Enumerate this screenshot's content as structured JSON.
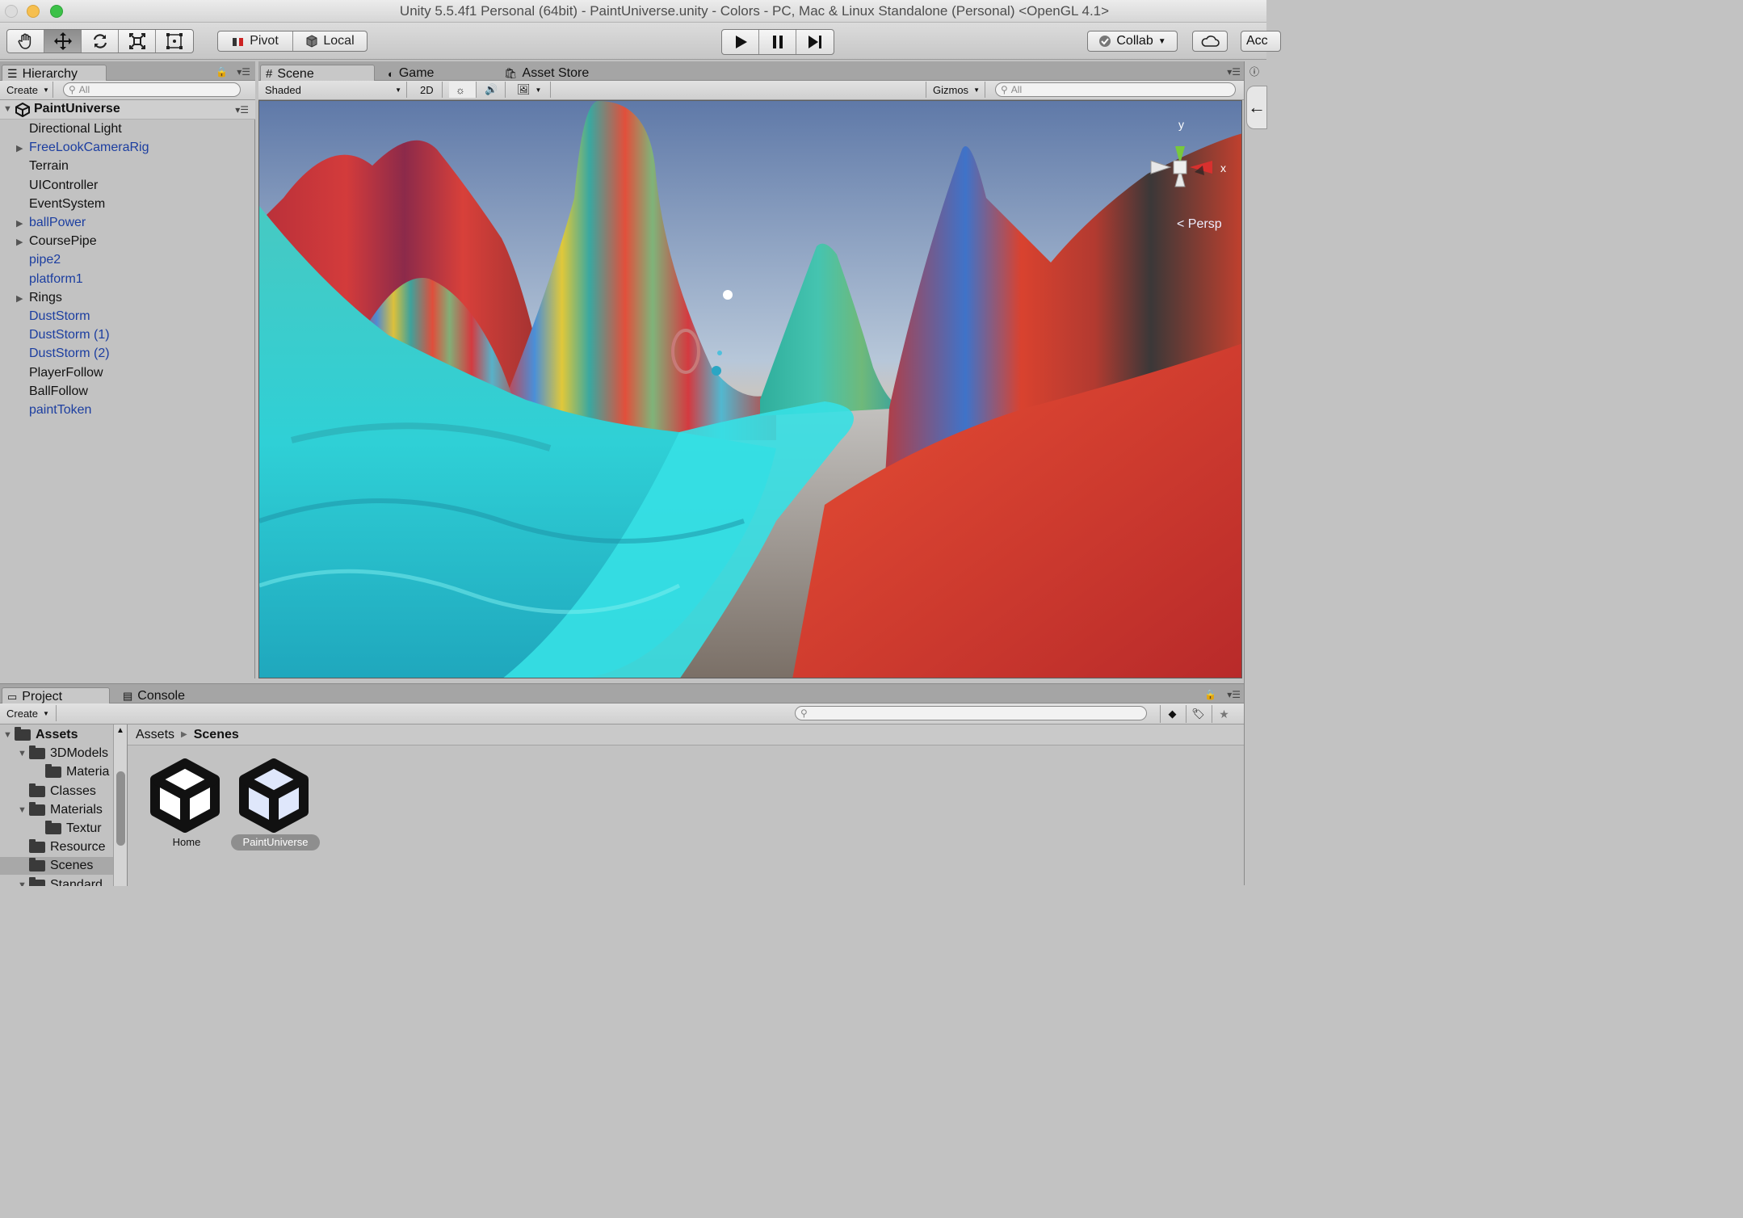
{
  "window": {
    "title": "Unity 5.5.4f1 Personal (64bit) - PaintUniverse.unity - Colors - PC, Mac & Linux Standalone (Personal) <OpenGL 4.1>"
  },
  "toolbar": {
    "tools": [
      "hand-tool",
      "move-tool",
      "rotate-tool",
      "scale-tool",
      "rect-tool"
    ],
    "active_tool": "move-tool",
    "pivot_label": "Pivot",
    "local_label": "Local",
    "collab_label": "Collab",
    "account_label": "Acc"
  },
  "hierarchy": {
    "tab_label": "Hierarchy",
    "create_label": "Create",
    "search_placeholder": "All",
    "scene_name": "PaintUniverse",
    "items": [
      {
        "label": "Directional Light",
        "prefab": false,
        "expandable": false
      },
      {
        "label": "FreeLookCameraRig",
        "prefab": true,
        "expandable": true
      },
      {
        "label": "Terrain",
        "prefab": false,
        "expandable": false
      },
      {
        "label": "UIController",
        "prefab": false,
        "expandable": false
      },
      {
        "label": "EventSystem",
        "prefab": false,
        "expandable": false
      },
      {
        "label": "ballPower",
        "prefab": true,
        "expandable": true
      },
      {
        "label": "CoursePipe",
        "prefab": false,
        "expandable": true
      },
      {
        "label": "pipe2",
        "prefab": true,
        "expandable": false
      },
      {
        "label": "platform1",
        "prefab": true,
        "expandable": false
      },
      {
        "label": "Rings",
        "prefab": false,
        "expandable": true
      },
      {
        "label": "DustStorm",
        "prefab": true,
        "expandable": false
      },
      {
        "label": "DustStorm (1)",
        "prefab": true,
        "expandable": false
      },
      {
        "label": "DustStorm (2)",
        "prefab": true,
        "expandable": false
      },
      {
        "label": "PlayerFollow",
        "prefab": false,
        "expandable": false
      },
      {
        "label": "BallFollow",
        "prefab": false,
        "expandable": false
      },
      {
        "label": "paintToken",
        "prefab": true,
        "expandable": false
      }
    ]
  },
  "scene_tabs": [
    {
      "label": "Scene",
      "selected": true
    },
    {
      "label": "Game",
      "selected": false
    },
    {
      "label": "Asset Store",
      "selected": false
    }
  ],
  "scene_toolbar": {
    "shading_mode": "Shaded",
    "mode_2d": "2D",
    "gizmos_label": "Gizmos",
    "search_placeholder": "All"
  },
  "scene_gizmo": {
    "y_label": "y",
    "x_label": "x",
    "projection": "Persp"
  },
  "project": {
    "tabs": [
      {
        "label": "Project",
        "selected": true
      },
      {
        "label": "Console",
        "selected": false
      }
    ],
    "create_label": "Create",
    "tree": [
      {
        "label": "Assets",
        "bold": true,
        "expanded": true,
        "depth": 0
      },
      {
        "label": "3DModels",
        "bold": false,
        "expanded": true,
        "depth": 1
      },
      {
        "label": "Materia",
        "bold": false,
        "expanded": false,
        "depth": 2
      },
      {
        "label": "Classes",
        "bold": false,
        "expanded": false,
        "depth": 1
      },
      {
        "label": "Materials",
        "bold": false,
        "expanded": true,
        "depth": 1
      },
      {
        "label": "Textur",
        "bold": false,
        "expanded": false,
        "depth": 2
      },
      {
        "label": "Resource",
        "bold": false,
        "expanded": false,
        "depth": 1
      },
      {
        "label": "Scenes",
        "bold": false,
        "expanded": false,
        "depth": 1,
        "selected": true
      },
      {
        "label": "Standard",
        "bold": false,
        "expanded": true,
        "depth": 1
      }
    ],
    "breadcrumb": [
      "Assets",
      "Scenes"
    ],
    "assets": [
      {
        "label": "Home",
        "selected": false
      },
      {
        "label": "PaintUniverse",
        "selected": true
      }
    ]
  },
  "colors": {
    "prefab_text": "#1c3ea0",
    "panel_bg": "#c2c2c2",
    "selection": "#a8a8a8"
  }
}
